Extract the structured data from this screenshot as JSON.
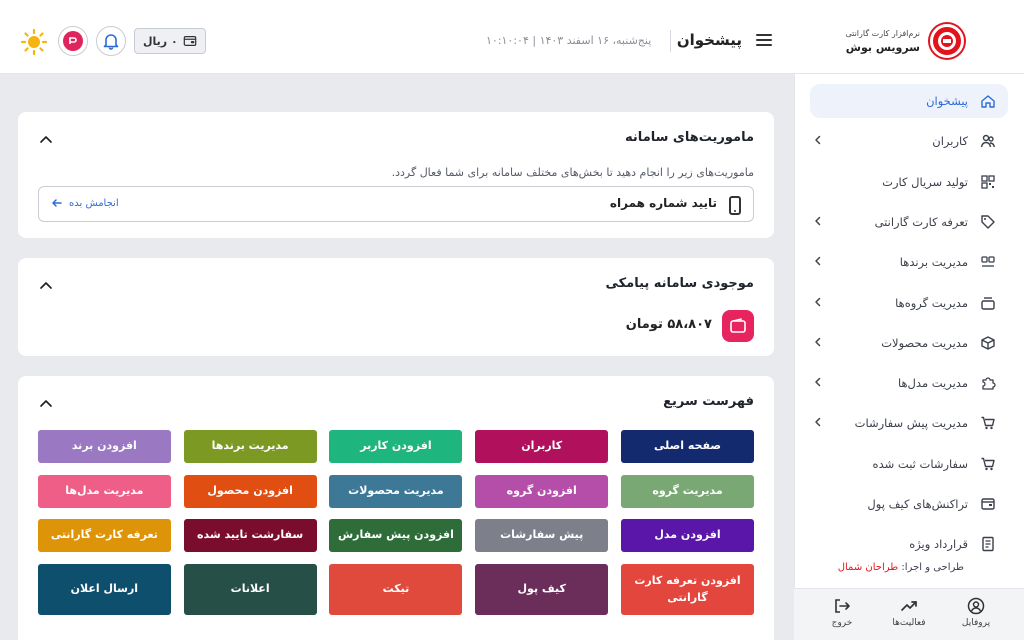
{
  "header": {
    "brand_sub": "نرم‌افزار کارت گارانتی",
    "brand_name": "سرویس بوش",
    "page_title": "پیشخوان",
    "date_text": "پنج‌شنبه، ۱۶ اسفند ۱۴۰۳ | ۱۰:۱۰:۰۴",
    "wallet_balance": "۰ ریال"
  },
  "sidebar": {
    "items": [
      {
        "label": "پیشخوان",
        "icon": "home-icon",
        "active": true,
        "chevron": false
      },
      {
        "label": "کاربران",
        "icon": "users-icon",
        "active": false,
        "chevron": true
      },
      {
        "label": "تولید سریال کارت",
        "icon": "qr-icon",
        "active": false,
        "chevron": false
      },
      {
        "label": "تعرفه کارت گارانتی",
        "icon": "tag-icon",
        "active": false,
        "chevron": true
      },
      {
        "label": "مدیریت برندها",
        "icon": "brands-icon",
        "active": false,
        "chevron": true
      },
      {
        "label": "مدیریت گروه‌ها",
        "icon": "groups-icon",
        "active": false,
        "chevron": true
      },
      {
        "label": "مدیریت محصولات",
        "icon": "box-icon",
        "active": false,
        "chevron": true
      },
      {
        "label": "مدیریت مدل‌ها",
        "icon": "puzzle-icon",
        "active": false,
        "chevron": true
      },
      {
        "label": "مدیریت پیش سفارشات",
        "icon": "cart-icon",
        "active": false,
        "chevron": true
      },
      {
        "label": "سفارشات ثبت شده",
        "icon": "cart-check-icon",
        "active": false,
        "chevron": false
      },
      {
        "label": "تراکنش‌های کیف پول",
        "icon": "wallet-icon",
        "active": false,
        "chevron": false
      },
      {
        "label": "قرارداد ویژه",
        "icon": "document-icon",
        "active": false,
        "chevron": false
      }
    ],
    "credit_prefix": "طراحی و اجرا:",
    "credit_name": "طراحان شمال",
    "bottom": {
      "profile": "پروفایل",
      "activities": "فعالیت‌ها",
      "logout": "خروج"
    }
  },
  "missions": {
    "title": "ماموریت‌های سامانه",
    "description": "ماموریت‌های زیر را انجام دهید تا بخش‌های مختلف سامانه برای شما فعال گردد.",
    "item_label": "تایید شماره همراه",
    "action_label": "انجامش بده"
  },
  "sms": {
    "title": "موجودی سامانه پیامکی",
    "balance": "۵۸،۸۰۷ تومان"
  },
  "quick": {
    "title": "فهرست سریع",
    "buttons": [
      {
        "label": "صفحه اصلی",
        "color": "#142a6e"
      },
      {
        "label": "کاربران",
        "color": "#b0105c"
      },
      {
        "label": "افزودن کاربر",
        "color": "#1fb57f"
      },
      {
        "label": "مدیریت برندها",
        "color": "#7c9a23"
      },
      {
        "label": "افزودن برند",
        "color": "#9a78c2"
      },
      {
        "label": "مدیریت گروه",
        "color": "#7aa874"
      },
      {
        "label": "افزودن گروه",
        "color": "#b54ea9"
      },
      {
        "label": "مدیریت محصولات",
        "color": "#3d7896"
      },
      {
        "label": "افزودن محصول",
        "color": "#e04e12"
      },
      {
        "label": "مدیریت مدل‌ها",
        "color": "#ee5e86"
      },
      {
        "label": "افزودن مدل",
        "color": "#5a16a8"
      },
      {
        "label": "پیش سفارشات",
        "color": "#7d808b"
      },
      {
        "label": "افزودن پیش سفارش",
        "color": "#2e6d3a"
      },
      {
        "label": "سفارشت تایید شده",
        "color": "#7a0c2e"
      },
      {
        "label": "تعرفه کارت گارانتی",
        "color": "#de9408"
      },
      {
        "label": "افزودن تعرفه کارت گارانتی",
        "color": "#e2463d"
      },
      {
        "label": "کیف پول",
        "color": "#6b2d5a"
      },
      {
        "label": "تیکت",
        "color": "#e04a3c"
      },
      {
        "label": "اعلانات",
        "color": "#264f48"
      },
      {
        "label": "ارسال اعلان",
        "color": "#0f4f6e"
      }
    ]
  }
}
